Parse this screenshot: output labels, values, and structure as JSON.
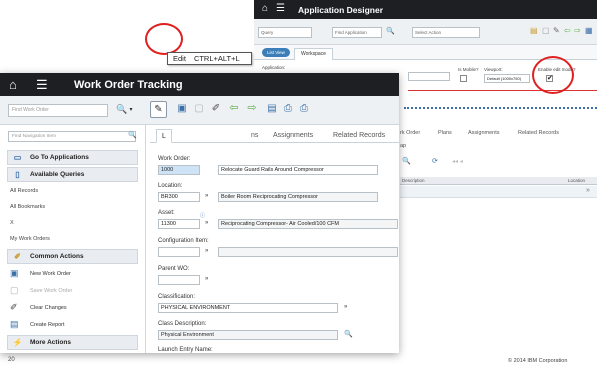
{
  "app_designer": {
    "title": "Application Designer",
    "query_select": "Query",
    "find_application": "Find Application",
    "select_action": "Select Action",
    "tabs": [
      "List View",
      "Workspace"
    ],
    "field_labels": {
      "application": "Application:",
      "is_mobile": "Is Mobile?",
      "viewport": "Viewport:",
      "enable_edit_mode": "Enable edit mode?"
    },
    "viewport_value": "Default (1000x750)",
    "enable_edit_mode_checked": "✔",
    "under_tabs": [
      "rk Order",
      "Plans",
      "Assignments",
      "Related Records"
    ],
    "under_subtab": "ap",
    "grid_headers": [
      "Description",
      "Location"
    ]
  },
  "work_order": {
    "title": "Work Order Tracking",
    "find_placeholder": "Find Work Order",
    "nav_placeholder": "Find Navigation Item",
    "tooltip": {
      "label": "Edit",
      "shortcut": "CTRL+ALT+L"
    },
    "sidebar": {
      "go_to_applications": "Go To Applications",
      "available_queries": "Available Queries",
      "queries": [
        "All Records",
        "All Bookmarks",
        "X",
        "My Work Orders"
      ],
      "common_actions": "Common Actions",
      "actions": [
        {
          "label": "New Work Order",
          "icon": "new-document-icon",
          "enabled": true
        },
        {
          "label": "Save Work Order",
          "icon": "save-icon",
          "enabled": false
        },
        {
          "label": "Clear Changes",
          "icon": "eraser-icon",
          "enabled": true
        },
        {
          "label": "Create Report",
          "icon": "report-icon",
          "enabled": true
        }
      ],
      "more_actions": "More Actions"
    },
    "tabs": [
      "L",
      "ns",
      "Assignments",
      "Related Records"
    ],
    "form": {
      "work_order_label": "Work Order:",
      "work_order_value": "1000",
      "work_order_desc": "Relocate Guard Rails Around Compressor",
      "location_label": "Location:",
      "location_value": "BR300",
      "location_desc": "Boiler Room Reciprocating Compressor",
      "asset_label": "Asset:",
      "asset_value": "11300",
      "asset_desc": "Reciprocating Compressor- Air Cooled/100 CFM",
      "config_item_label": "Configuration Item:",
      "parent_wo_label": "Parent WO:",
      "classification_label": "Classification:",
      "classification_value": "PHYSICAL ENVIRONMENT",
      "class_description_label": "Class Description:",
      "class_description_value": "Physical Environment",
      "launch_entry_label": "Launch Entry Name:"
    }
  },
  "footer": {
    "page_number": "20",
    "copyright": "© 2014 IBM Corporation"
  }
}
